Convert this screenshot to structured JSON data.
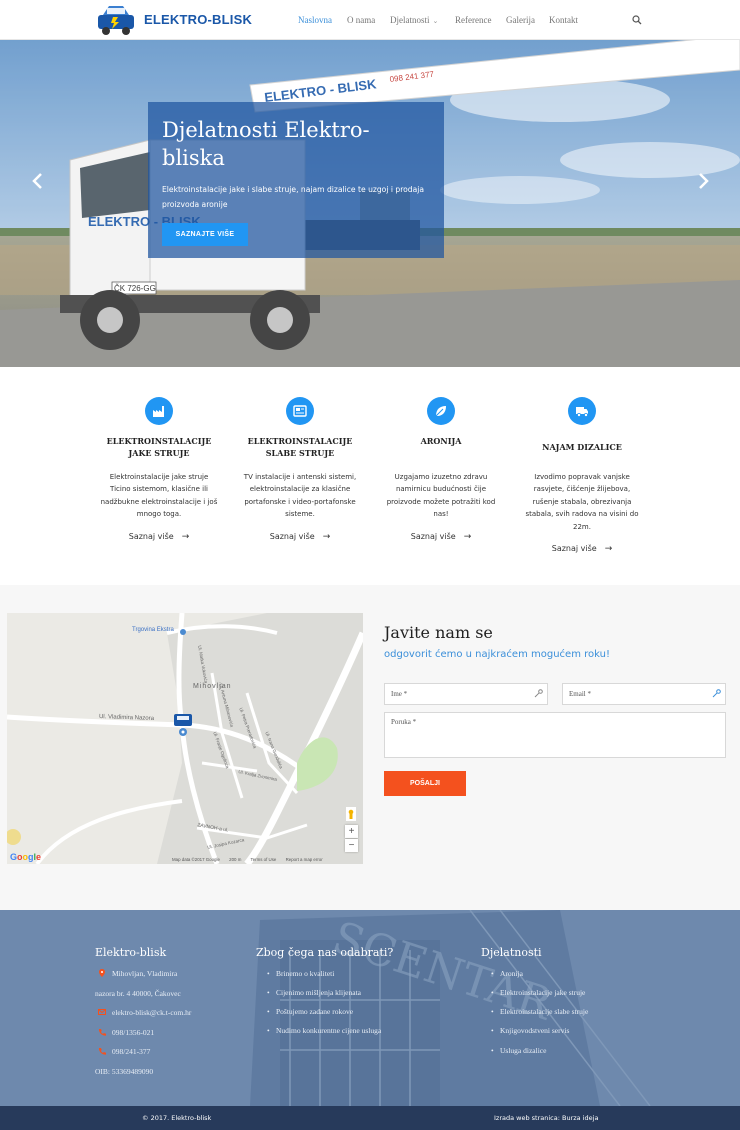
{
  "header": {
    "brand": "ELEKTRO-BLISK",
    "nav": [
      {
        "label": "Naslovna",
        "active": true
      },
      {
        "label": "O nama",
        "active": false
      },
      {
        "label": "Djelatnosti",
        "active": false,
        "has_dropdown": true
      },
      {
        "label": "Reference",
        "active": false
      },
      {
        "label": "Galerija",
        "active": false
      },
      {
        "label": "Kontakt",
        "active": false
      }
    ],
    "search_icon": "search-icon"
  },
  "hero": {
    "title": "Djelatnosti Elektro-bliska",
    "text": "Elektroinstalacije jake i slabe struje, najam dizalice te uzgoj i prodaja proizvoda aronije",
    "button": "SAZNAJTE VIŠE",
    "truck_boom_text": "ELEKTRO - BLISK",
    "truck_phone": "098 241 377",
    "truck_door_text": "ELEKTRO - BLISK",
    "plate": "ČK 726-GG"
  },
  "services": [
    {
      "icon": "factory-icon",
      "title": "ELEKTROINSTALACIJE JAKE STRUJE",
      "desc": "Elektroinstalacije jake struje Ticino sistemom, klasične ili nadžbukne elektroinstalacije i još mnogo toga.",
      "link": "Saznaj više"
    },
    {
      "icon": "newspaper-icon",
      "title": "ELEKTROINSTALACIJE SLABE STRUJE",
      "desc": "TV instalacije i antenski sistemi, elektroinstalacije za klasične portafonske i video-portafonske sisteme.",
      "link": "Saznaj više"
    },
    {
      "icon": "leaf-icon",
      "title": "ARONIJA",
      "desc": "Uzgajamo izuzetno zdravu namirnicu budućnosti čije proizvode možete potražiti kod nas!",
      "link": "Saznaj više"
    },
    {
      "icon": "truck-icon",
      "title": "NAJAM DIZALICE",
      "desc": "Izvodimo popravak vanjske rasvjete, čišćenje žlijebova, rušenje stabala, obrezivanja stabala, svih radova na visini do 22m.",
      "link": "Saznaj više"
    }
  ],
  "map": {
    "labels": {
      "store": "Trgovina Ekstra",
      "village": "Mihovljan",
      "street1": "Ul. Vladimira Nazora",
      "street2": "Ul. Matka Vukovića",
      "street3": "Ul. Antuna Mihanovića",
      "street4": "Ul. Petra Preradovića",
      "street5": "Ul. Ivana Gundulića",
      "street6": "Ul. Franje Ogulinca",
      "street7": "Ul. Kralja Zvonimira",
      "street8": "ZAVNOH-a ul.",
      "street9": "Ul. Josipa Kozarca"
    },
    "google": "Google",
    "footer": [
      "Map data ©2017 Google",
      "200 m",
      "Terms of Use",
      "Report a map error"
    ],
    "zoom_in": "+",
    "zoom_out": "−"
  },
  "contact": {
    "title": "Javite nam se",
    "subtitle": "odgovorit ćemo u najkraćem mogućem roku!",
    "name_placeholder": "Ime *",
    "email_placeholder": "Email *",
    "message_placeholder": "Poruka *",
    "send": "POŠALJI"
  },
  "footer": {
    "col1": {
      "title": "Elektro-blisk",
      "address1": "Mihovljan, Vladimira",
      "address2": "nazora br. 4 40000, Čakovec",
      "email": "elektro-blisk@ck.t-com.hr",
      "phone1": "098/1356-021",
      "phone2": "098/241-377",
      "oib": "OIB: 53369489090"
    },
    "col2": {
      "title": "Zbog čega nas odabrati?",
      "items": [
        "Brinemo o kvaliteti",
        "Cijenimo mišljenja klijenata",
        "Poštujemo zadane rokove",
        "Nudimo konkurentne cijene usluga"
      ]
    },
    "col3": {
      "title": "Djelatnosti",
      "items": [
        "Aronija",
        "Elektroinstalacije jake struje",
        "Elektroinstalacije slabe struje",
        "Knjigovodstveni servis",
        "Usluga dizalice"
      ]
    },
    "copyright": "© 2017. Elektro-blisk",
    "credit": "Izrada web stranica: Burza ideja"
  },
  "colors": {
    "primary": "#2196f3",
    "brand": "#1a57a8",
    "accent": "#f4511e",
    "footer_bar": "#273a5b"
  }
}
